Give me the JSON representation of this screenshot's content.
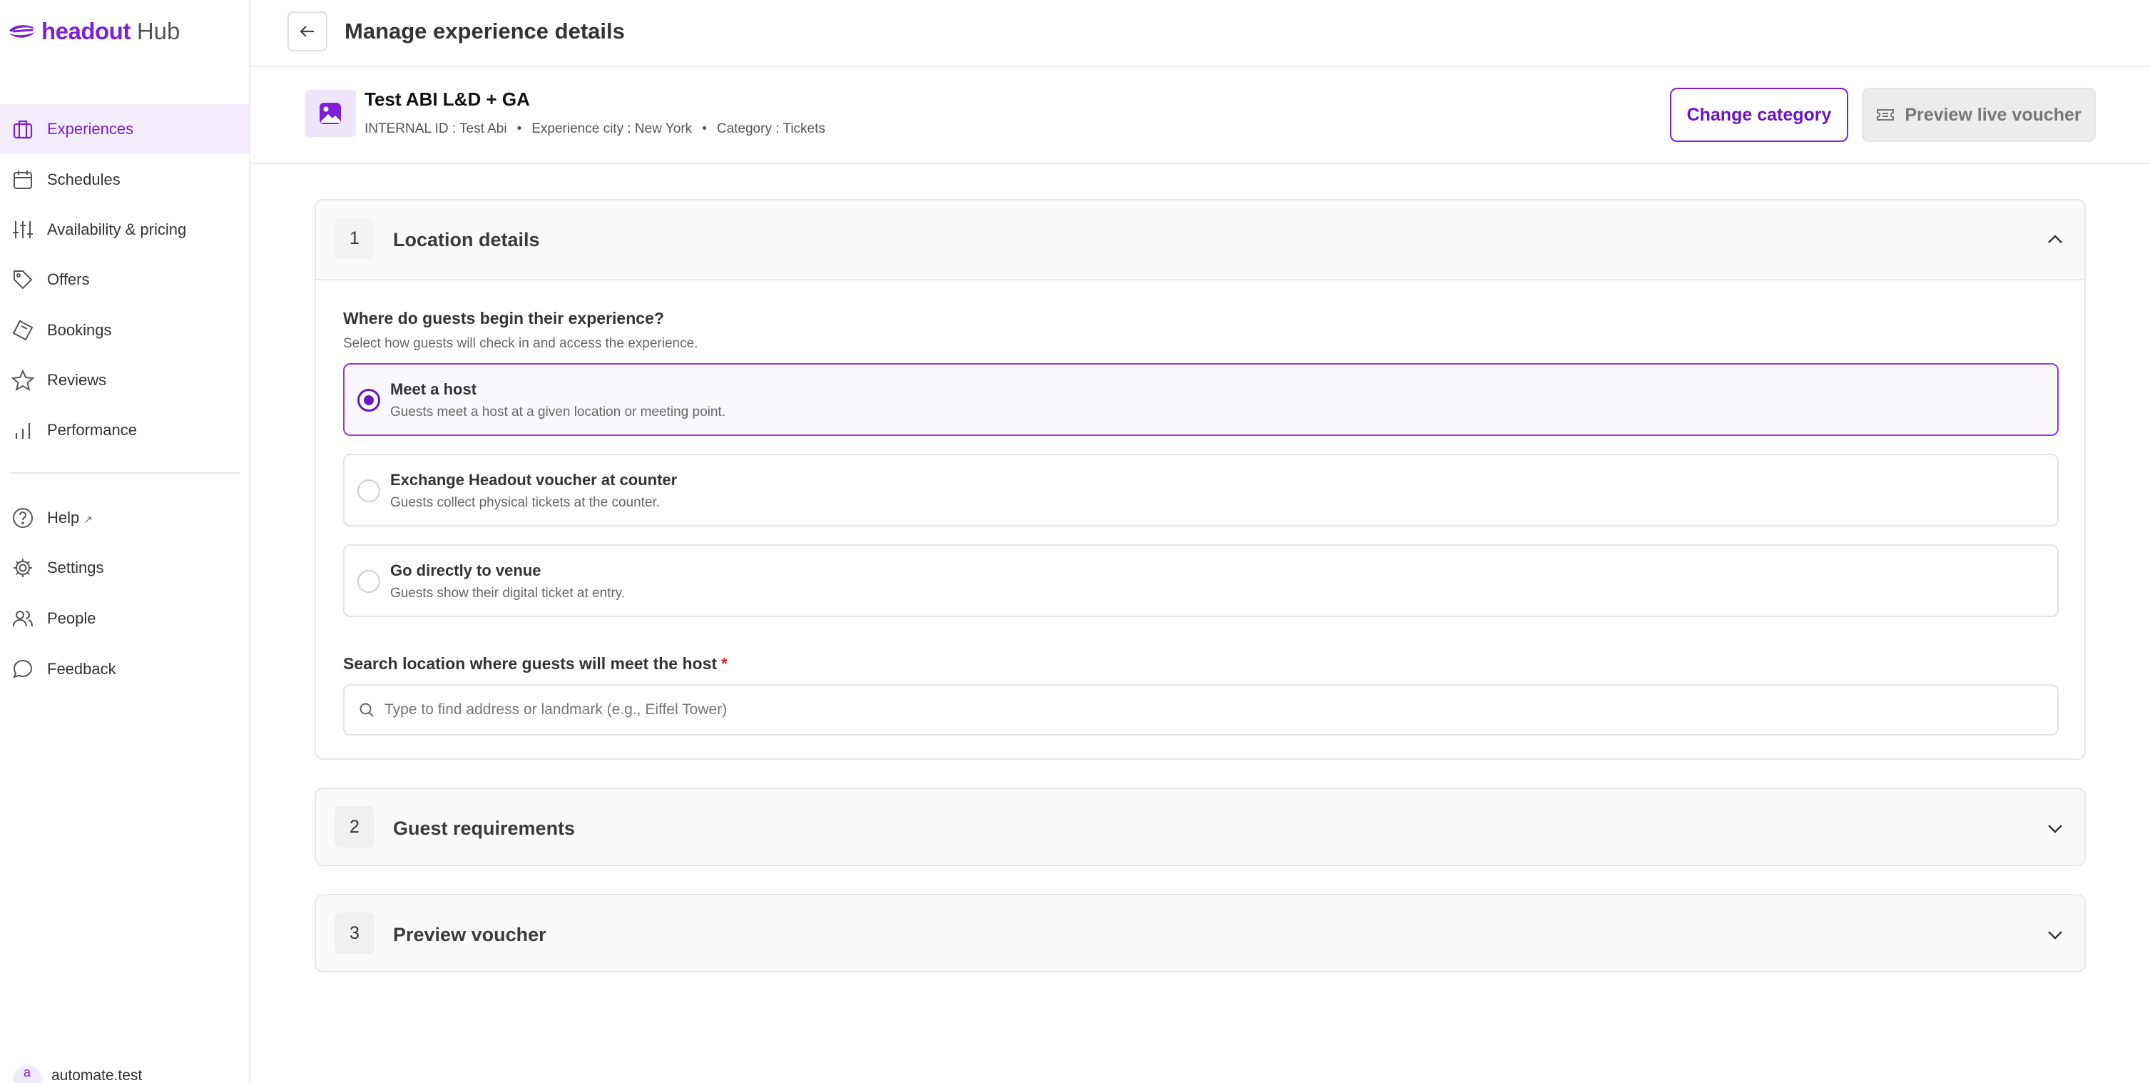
{
  "brand": {
    "name": "headout",
    "suffix": "Hub",
    "accent": "#7e1fd6"
  },
  "sidebar": {
    "items": [
      {
        "label": "Experiences",
        "icon": "briefcase-icon",
        "active": true
      },
      {
        "label": "Schedules",
        "icon": "calendar-icon"
      },
      {
        "label": "Availability & pricing",
        "icon": "sliders-icon"
      },
      {
        "label": "Offers",
        "icon": "tag-icon"
      },
      {
        "label": "Bookings",
        "icon": "ticket-icon"
      },
      {
        "label": "Reviews",
        "icon": "star-icon"
      },
      {
        "label": "Performance",
        "icon": "bar-chart-icon"
      }
    ],
    "secondary": [
      {
        "label": "Help",
        "icon": "help-circle-icon",
        "external": true
      },
      {
        "label": "Settings",
        "icon": "gear-icon"
      },
      {
        "label": "People",
        "icon": "users-icon"
      },
      {
        "label": "Feedback",
        "icon": "message-icon"
      }
    ],
    "user": {
      "initial": "a",
      "name": "automate.test"
    }
  },
  "header": {
    "title": "Manage experience details"
  },
  "experience": {
    "name": "Test ABI L&D + GA",
    "internal_id": "INTERNAL ID : Test Abi",
    "city": "Experience city : New York",
    "category": "Category : Tickets",
    "separator": "•",
    "change_category_label": "Change category",
    "preview_label": "Preview live voucher"
  },
  "sections": [
    {
      "number": "1",
      "title": "Location details",
      "expanded": true,
      "question": "Where do guests begin their experience?",
      "question_hint": "Select how guests will check in and access the experience.",
      "options": [
        {
          "title": "Meet a host",
          "desc": "Guests meet a host at a given location or meeting point.",
          "selected": true
        },
        {
          "title": "Exchange Headout voucher at counter",
          "desc": "Guests collect physical tickets at the counter.",
          "selected": false
        },
        {
          "title": "Go directly to venue",
          "desc": "Guests show their digital ticket at entry.",
          "selected": false
        }
      ],
      "location_label": "Search location where guests will meet the host",
      "required_mark": "*",
      "search_placeholder": "Type to find address or landmark (e.g., Eiffel Tower)",
      "search_value": ""
    },
    {
      "number": "2",
      "title": "Guest requirements",
      "expanded": false
    },
    {
      "number": "3",
      "title": "Preview voucher",
      "expanded": false
    }
  ]
}
